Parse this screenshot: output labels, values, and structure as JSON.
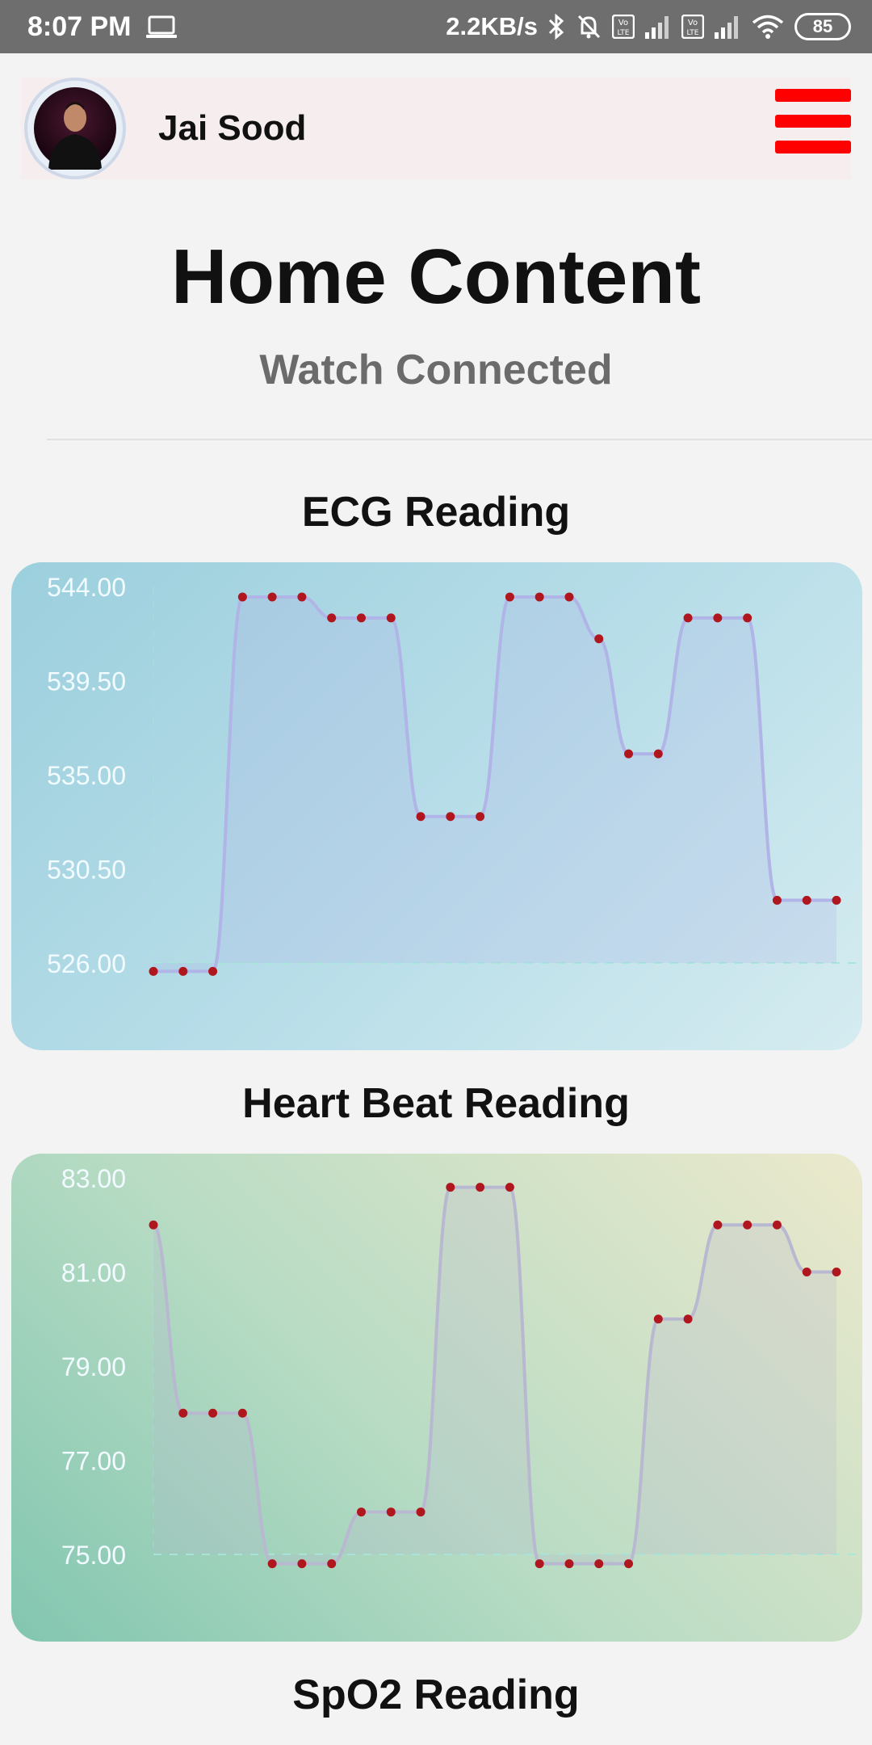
{
  "status_bar": {
    "time": "8:07 PM",
    "speed": "2.2KB/s",
    "battery": "85",
    "icons": [
      "laptop-icon",
      "bluetooth-icon",
      "mute-icon",
      "volte-icon",
      "signal-icon",
      "wifi-icon",
      "battery-icon"
    ]
  },
  "header": {
    "user_name": "Jai Sood",
    "menu_color": "#ff0000"
  },
  "page": {
    "title": "Home Content",
    "subtitle": "Watch Connected"
  },
  "sections": {
    "ecg_title": "ECG Reading",
    "heartbeat_title": "Heart Beat Reading",
    "spo2_title": "SpO2 Reading"
  },
  "chart_data": [
    {
      "type": "line",
      "id": "ecg",
      "yticks": [
        "544.00",
        "539.50",
        "535.00",
        "530.50",
        "526.00"
      ],
      "ylim": [
        526,
        544
      ],
      "values": [
        525.6,
        525.6,
        525.6,
        543.5,
        543.5,
        543.5,
        542.5,
        542.5,
        542.5,
        533.0,
        533.0,
        533.0,
        543.5,
        543.5,
        543.5,
        541.5,
        536.0,
        536.0,
        542.5,
        542.5,
        542.5,
        529.0,
        529.0,
        529.0
      ],
      "line_color": "#b0b4e6",
      "point_color": "#b0161e"
    },
    {
      "type": "line",
      "id": "heartbeat",
      "yticks": [
        "83.00",
        "81.00",
        "79.00",
        "77.00",
        "75.00"
      ],
      "ylim": [
        75,
        83
      ],
      "values": [
        82.0,
        78.0,
        78.0,
        78.0,
        74.8,
        74.8,
        74.8,
        75.9,
        75.9,
        75.9,
        82.8,
        82.8,
        82.8,
        74.8,
        74.8,
        74.8,
        74.8,
        80.0,
        80.0,
        82.0,
        82.0,
        82.0,
        81.0,
        81.0
      ],
      "line_color": "#b8b8d0",
      "point_color": "#b0161e"
    }
  ]
}
